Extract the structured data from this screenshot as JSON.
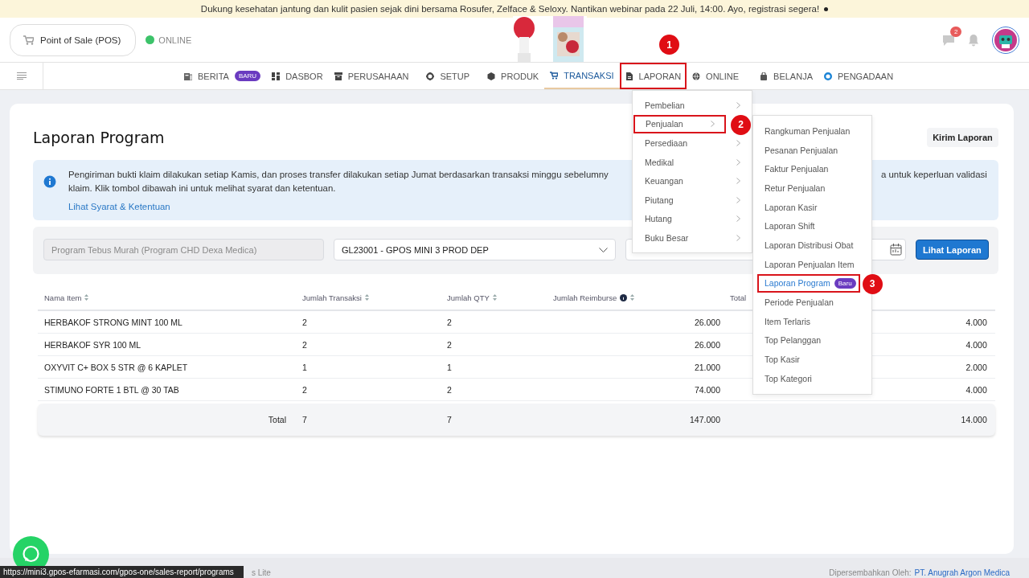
{
  "announcement": {
    "text": "Dukung kesehatan jantung dan kulit pasien sejak dini bersama Rosufer, Zelface & Seloxy. Nantikan webinar pada 22 Juli, 14:00. Ayo, registrasi segera!"
  },
  "header": {
    "app_button": "Point of Sale (POS)",
    "connection": {
      "label": "ONLINE",
      "online": true
    },
    "messages_badge": "2"
  },
  "nav": {
    "items": [
      {
        "label": "BERITA",
        "badge": "BARU",
        "selected": false
      },
      {
        "label": "DASBOR",
        "selected": false
      },
      {
        "label": "PERUSAHAAN",
        "selected": false
      },
      {
        "label": "SETUP",
        "selected": false
      },
      {
        "label": "PRODUK",
        "selected": false
      },
      {
        "label": "TRANSAKSI",
        "selected": true
      },
      {
        "label": "LAPORAN",
        "selected": false,
        "callout": "1"
      },
      {
        "label": "ONLINE",
        "selected": false
      },
      {
        "label": "BELANJA",
        "selected": false
      },
      {
        "label": "PENGADAAN",
        "selected": false
      }
    ]
  },
  "laporan_menu": {
    "items": [
      {
        "label": "Pembelian"
      },
      {
        "label": "Penjualan",
        "callout": "2"
      },
      {
        "label": "Persediaan"
      },
      {
        "label": "Medikal"
      },
      {
        "label": "Keuangan"
      },
      {
        "label": "Piutang"
      },
      {
        "label": "Hutang"
      },
      {
        "label": "Buku Besar"
      }
    ]
  },
  "penjualan_submenu": {
    "items": [
      {
        "label": "Rangkuman Penjualan",
        "selected": false
      },
      {
        "label": "Pesanan Penjualan",
        "selected": false
      },
      {
        "label": "Faktur Penjualan",
        "selected": false
      },
      {
        "label": "Retur Penjualan",
        "selected": false
      },
      {
        "label": "Laporan Kasir",
        "selected": false
      },
      {
        "label": "Laporan Shift",
        "selected": false
      },
      {
        "label": "Laporan Distribusi Obat",
        "selected": false
      },
      {
        "label": "Laporan Penjualan Item",
        "selected": false
      },
      {
        "label": "Laporan Program",
        "badge": "Baru",
        "selected": true,
        "callout": "3"
      },
      {
        "label": "Periode Penjualan",
        "selected": false
      },
      {
        "label": "Item Terlaris",
        "selected": false
      },
      {
        "label": "Top Pelanggan",
        "selected": false
      },
      {
        "label": "Top Kasir",
        "selected": false
      },
      {
        "label": "Top Kategori",
        "selected": false
      }
    ]
  },
  "page": {
    "title": "Laporan Program",
    "send_button": "Kirim Laporan",
    "notice": {
      "line_1_start": "Pengiriman bukti klaim dilakukan setiap Kamis, dan proses transfer dilakukan setiap Jumat berdasarkan transaksi minggu sebelumny",
      "line_1_end": "a untuk keperluan validasi",
      "line_2": "klaim. Klik tombol dibawah ini untuk melihat syarat dan ketentuan.",
      "link": "Lihat Syarat & Ketentuan"
    },
    "filters": {
      "program": "Program Tebus Murah (Program CHD Dexa Medica)",
      "outlet": "GL23001 - GPOS MINI 3 PROD DEP",
      "view_button": "Lihat Laporan"
    }
  },
  "table": {
    "columns": [
      {
        "label": "Nama Item",
        "sortable": true
      },
      {
        "label": "Jumlah Transaksi",
        "sortable": true
      },
      {
        "label": "Jumlah QTY",
        "sortable": true
      },
      {
        "label": "Jumlah Reimburse",
        "sortable": true,
        "info": true
      },
      {
        "label": "Total",
        "sortable": false
      }
    ],
    "rows": [
      {
        "nama_item": "HERBAKOF STRONG MINT 100 ML",
        "jumlah_transaksi": "2",
        "jumlah_qty": "2",
        "jumlah_reimburse": "26.000",
        "column_6": "4.000"
      },
      {
        "nama_item": "HERBAKOF SYR 100 ML",
        "jumlah_transaksi": "2",
        "jumlah_qty": "2",
        "jumlah_reimburse": "26.000",
        "column_6": "4.000"
      },
      {
        "nama_item": "OXYVIT C+ BOX 5 STR @ 6 KAPLET",
        "jumlah_transaksi": "1",
        "jumlah_qty": "1",
        "jumlah_reimburse": "21.000",
        "column_6": "2.000"
      },
      {
        "nama_item": "STIMUNO FORTE 1 BTL @ 30 TAB",
        "jumlah_transaksi": "2",
        "jumlah_qty": "2",
        "jumlah_reimburse": "74.000",
        "column_6": "4.000"
      }
    ],
    "total_row": {
      "label": "Total",
      "jumlah_transaksi": "7",
      "jumlah_qty": "7",
      "jumlah_reimburse": "147.000",
      "column_6": "14.000"
    }
  },
  "footer": {
    "left_text": "s Lite",
    "credit": "Dipersembahkan Oleh:",
    "credit_link": "PT. Anugrah Argon Medica"
  },
  "status_url": "https://mini3.gpos-efarmasi.com/gpos-one/sales-report/programs"
}
